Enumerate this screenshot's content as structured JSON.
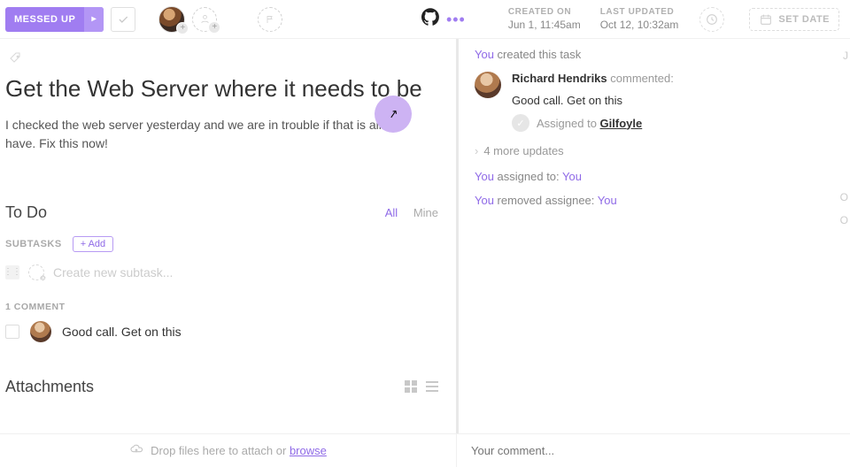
{
  "toolbar": {
    "status": "MESSED UP",
    "created_label": "CREATED ON",
    "created_value": "Jun 1, 11:45am",
    "updated_label": "LAST UPDATED",
    "updated_value": "Oct 12, 10:32am",
    "set_date": "SET DATE"
  },
  "task": {
    "title": "Get the Web Server where it needs to be",
    "description": "I checked the web server yesterday and we are in trouble if that is all we have. Fix this now!"
  },
  "todo": {
    "heading": "To Do",
    "filter_all": "All",
    "filter_mine": "Mine",
    "subtasks_label": "SUBTASKS",
    "add_label": "+ Add",
    "new_placeholder": "Create new subtask..."
  },
  "comments": {
    "heading": "1 COMMENT",
    "item": "Good call. Get on this"
  },
  "attachments": {
    "heading": "Attachments"
  },
  "activity": {
    "created": {
      "you": "You",
      "rest": " created this task"
    },
    "commented": {
      "name": "Richard Hendriks",
      "verb": " commented:",
      "body": "Good call. Get on this",
      "assigned_to_label": "Assigned to ",
      "assigned_to": "Gilfoyle"
    },
    "more_updates": "4 more updates",
    "assigned": {
      "you1": "You",
      "mid": " assigned to: ",
      "you2": "You"
    },
    "removed": {
      "you1": "You",
      "mid": " removed assignee: ",
      "you2": "You"
    },
    "edge1": "J",
    "edge2": "O",
    "edge3": "O"
  },
  "footer": {
    "drop_pre": "Drop files here to attach or ",
    "browse": "browse",
    "comment_placeholder": "Your comment..."
  }
}
